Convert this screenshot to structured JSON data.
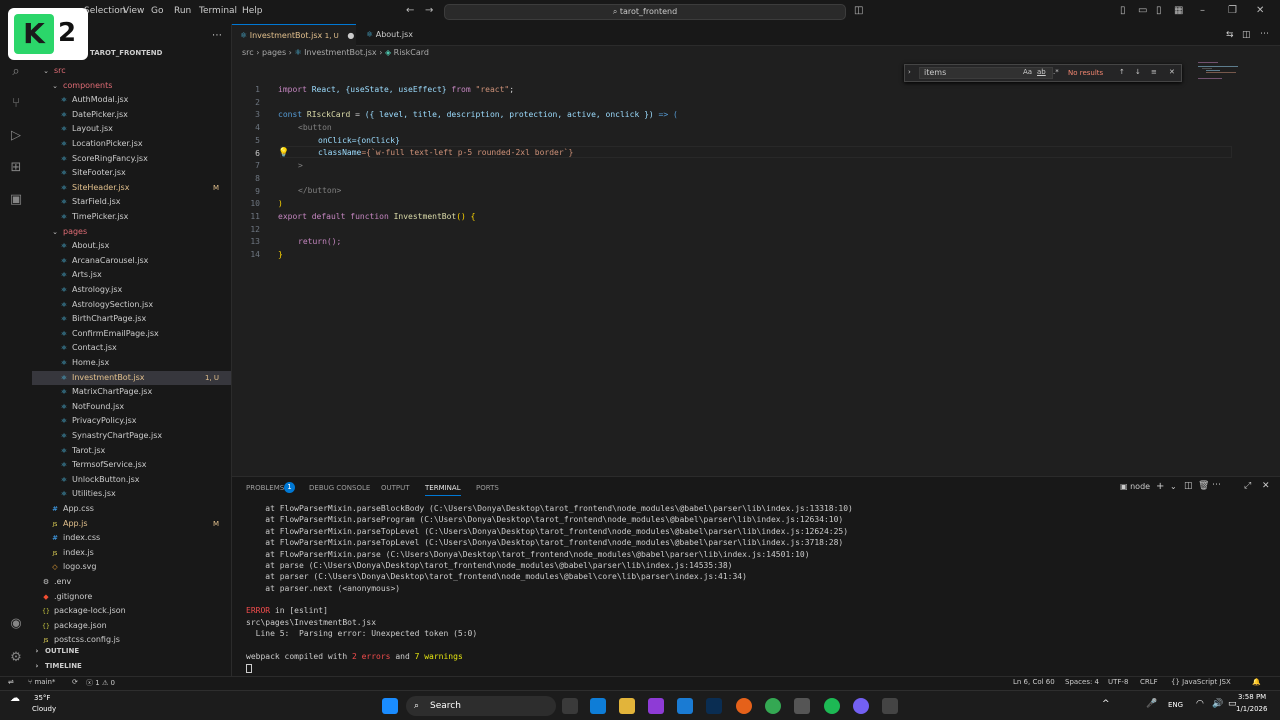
{
  "titlebar": {
    "logo_number": "2",
    "menu": [
      "Selection",
      "View",
      "Go",
      "Run",
      "Terminal",
      "Help"
    ],
    "search": "tarot_frontend"
  },
  "sidebar": {
    "header": "TAROT_FRONTEND",
    "items": [
      {
        "label": "src",
        "kind": "folder",
        "indent": 1
      },
      {
        "label": "components",
        "kind": "folder",
        "indent": 2
      },
      {
        "label": "AuthModal.jsx",
        "kind": "jsx",
        "indent": 3
      },
      {
        "label": "DatePicker.jsx",
        "kind": "jsx",
        "indent": 3
      },
      {
        "label": "Layout.jsx",
        "kind": "jsx",
        "indent": 3
      },
      {
        "label": "LocationPicker.jsx",
        "kind": "jsx",
        "indent": 3
      },
      {
        "label": "ScoreRingFancy.jsx",
        "kind": "jsx",
        "indent": 3
      },
      {
        "label": "SiteFooter.jsx",
        "kind": "jsx",
        "indent": 3
      },
      {
        "label": "SiteHeader.jsx",
        "kind": "jsx",
        "indent": 3,
        "badge": "M"
      },
      {
        "label": "StarField.jsx",
        "kind": "jsx",
        "indent": 3
      },
      {
        "label": "TimePicker.jsx",
        "kind": "jsx",
        "indent": 3
      },
      {
        "label": "pages",
        "kind": "folder",
        "indent": 2
      },
      {
        "label": "About.jsx",
        "kind": "jsx",
        "indent": 3
      },
      {
        "label": "ArcanaCarousel.jsx",
        "kind": "jsx",
        "indent": 3
      },
      {
        "label": "Arts.jsx",
        "kind": "jsx",
        "indent": 3
      },
      {
        "label": "Astrology.jsx",
        "kind": "jsx",
        "indent": 3
      },
      {
        "label": "AstrologySection.jsx",
        "kind": "jsx",
        "indent": 3
      },
      {
        "label": "BirthChartPage.jsx",
        "kind": "jsx",
        "indent": 3
      },
      {
        "label": "ConfirmEmailPage.jsx",
        "kind": "jsx",
        "indent": 3
      },
      {
        "label": "Contact.jsx",
        "kind": "jsx",
        "indent": 3
      },
      {
        "label": "Home.jsx",
        "kind": "jsx",
        "indent": 3
      },
      {
        "label": "InvestmentBot.jsx",
        "kind": "jsx",
        "indent": 3,
        "badge": "1, U",
        "selected": true
      },
      {
        "label": "MatrixChartPage.jsx",
        "kind": "jsx",
        "indent": 3
      },
      {
        "label": "NotFound.jsx",
        "kind": "jsx",
        "indent": 3
      },
      {
        "label": "PrivacyPolicy.jsx",
        "kind": "jsx",
        "indent": 3
      },
      {
        "label": "SynastryChartPage.jsx",
        "kind": "jsx",
        "indent": 3
      },
      {
        "label": "Tarot.jsx",
        "kind": "jsx",
        "indent": 3
      },
      {
        "label": "TermsofService.jsx",
        "kind": "jsx",
        "indent": 3
      },
      {
        "label": "UnlockButton.jsx",
        "kind": "jsx",
        "indent": 3
      },
      {
        "label": "Utilities.jsx",
        "kind": "jsx",
        "indent": 3
      },
      {
        "label": "App.css",
        "kind": "css",
        "indent": 2
      },
      {
        "label": "App.js",
        "kind": "js",
        "indent": 2,
        "badge": "M"
      },
      {
        "label": "index.css",
        "kind": "css",
        "indent": 2
      },
      {
        "label": "index.js",
        "kind": "js",
        "indent": 2
      },
      {
        "label": "logo.svg",
        "kind": "svg",
        "indent": 2
      },
      {
        "label": ".env",
        "kind": "env",
        "indent": 1
      },
      {
        "label": ".gitignore",
        "kind": "git",
        "indent": 1
      },
      {
        "label": "package-lock.json",
        "kind": "json",
        "indent": 1
      },
      {
        "label": "package.json",
        "kind": "json",
        "indent": 1
      },
      {
        "label": "postcss.config.js",
        "kind": "js",
        "indent": 1
      }
    ],
    "outline": "OUTLINE",
    "timeline": "TIMELINE"
  },
  "tabs": [
    {
      "label": "InvestmentBot.jsx",
      "badge": "1, U",
      "active": true
    },
    {
      "label": "About.jsx",
      "active": false
    }
  ],
  "breadcrumb": [
    "src",
    "pages",
    "InvestmentBot.jsx",
    "RiskCard"
  ],
  "find": {
    "query": "items",
    "result": "No results",
    "opts": [
      "Aa",
      "ab",
      ".*"
    ]
  },
  "code_lines": [
    {
      "n": "1"
    },
    {
      "n": "2"
    },
    {
      "n": "3"
    },
    {
      "n": "4"
    },
    {
      "n": "5"
    },
    {
      "n": "6"
    },
    {
      "n": "7"
    },
    {
      "n": "8"
    },
    {
      "n": "9"
    },
    {
      "n": "10"
    },
    {
      "n": "11"
    },
    {
      "n": "12"
    },
    {
      "n": "13"
    },
    {
      "n": "14"
    }
  ],
  "code": {
    "l1": {
      "kw": "import",
      "a": " React, ",
      "b": "{useState, useEffect}",
      "c": " from ",
      "str": "\"react\"",
      "end": ";"
    },
    "l3": {
      "kw": "const",
      "name": " RIsckCard",
      "eq": " = ",
      "args": "({ level, title, description, protection, active, onclick })",
      "arrow": " => ("
    },
    "l4": "<button",
    "l5": {
      "attr": "onClick",
      "val": "={onClick}"
    },
    "l6": {
      "attr": "className",
      "val": "={`w-full text-left p-5 rounded-2xl border`}"
    },
    "l7": ">",
    "l9": "</button>",
    "l10": ")",
    "l11": {
      "kw": "export default function",
      "fn": " InvestmentBot",
      "rest": "() {"
    },
    "l13": "return();",
    "l14": "}"
  },
  "panel": {
    "tabs": [
      "PROBLEMS",
      "DEBUG CONSOLE",
      "OUTPUT",
      "TERMINAL",
      "PORTS"
    ],
    "problems_count": "1",
    "node": "node",
    "lines": [
      "    at FlowParserMixin.parseBlockBody (C:\\Users\\Donya\\Desktop\\tarot_frontend\\node_modules\\@babel\\parser\\lib\\index.js:13318:10)",
      "    at FlowParserMixin.parseProgram (C:\\Users\\Donya\\Desktop\\tarot_frontend\\node_modules\\@babel\\parser\\lib\\index.js:12634:10)",
      "    at FlowParserMixin.parseTopLevel (C:\\Users\\Donya\\Desktop\\tarot_frontend\\node_modules\\@babel\\parser\\lib\\index.js:12624:25)",
      "    at FlowParserMixin.parseTopLevel (C:\\Users\\Donya\\Desktop\\tarot_frontend\\node_modules\\@babel\\parser\\lib\\index.js:3718:28)",
      "    at FlowParserMixin.parse (C:\\Users\\Donya\\Desktop\\tarot_frontend\\node_modules\\@babel\\parser\\lib\\index.js:14501:10)",
      "    at parse (C:\\Users\\Donya\\Desktop\\tarot_frontend\\node_modules\\@babel\\parser\\lib\\index.js:14535:38)",
      "    at parser (C:\\Users\\Donya\\Desktop\\tarot_frontend\\node_modules\\@babel\\core\\lib\\parser\\index.js:41:34)",
      "    at parser.next (<anonymous>)"
    ],
    "error_tag": "ERROR",
    "error_in": " in [eslint]",
    "error_file": "src\\pages\\InvestmentBot.jsx",
    "error_msg": "  Line 5:  Parsing error: Unexpected token (5:0)",
    "compiled_a": "webpack compiled with ",
    "compiled_err": "2 errors",
    "compiled_b": " and ",
    "compiled_warn": "7 warnings"
  },
  "status": {
    "branch": "main*",
    "errors": "1",
    "warnings": "0",
    "position": "Ln 6, Col 60",
    "spaces": "Spaces: 4",
    "encoding": "UTF-8",
    "eol": "CRLF",
    "lang": "JavaScript JSX"
  },
  "taskbar": {
    "temp": "35°F",
    "weather": "Cloudy",
    "search": "Search",
    "lang": "ENG",
    "time": "3:58 PM",
    "date": "1/1/2026"
  }
}
